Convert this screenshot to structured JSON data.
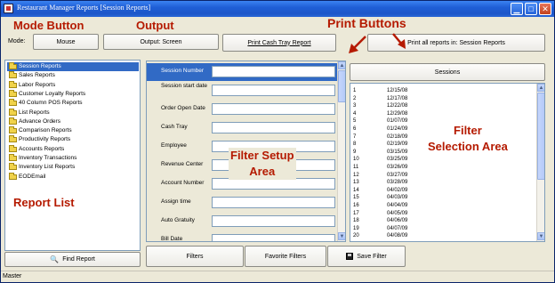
{
  "window": {
    "title": "Restaurant Manager Reports [Session Reports]"
  },
  "toolbar": {
    "mode_label": "Mode:",
    "mode_value": "Mouse",
    "output_button": "Output: Screen",
    "print_tray_button": "Print Cash Tray Report",
    "print_all_button": "Print all reports in: Session Reports"
  },
  "annotations": {
    "mode_button": "Mode Button",
    "output": "Output",
    "print_buttons": "Print Buttons",
    "filter_setup_area": "Filter Setup\nArea",
    "filter_selection_area": "Filter\nSelection Area",
    "report_list": "Report List"
  },
  "reports": {
    "items": [
      "Session Reports",
      "Sales Reports",
      "Labor Reports",
      "Customer Loyalty Reports",
      "40 Column POS Reports",
      "List Reports",
      "Advance Orders",
      "Comparison Reports",
      "Productivity Reports",
      "Accounts Reports",
      "Inventory Transactions",
      "Inventory List Reports",
      "EODEmail"
    ],
    "selected_index": 0,
    "find_button": "Find Report"
  },
  "filters": {
    "fields": [
      "Session Number",
      "Session start date",
      "Order Open Date",
      "Cash Tray",
      "Employee",
      "Revenue Center",
      "Account Number",
      "Assign time",
      "Auto Gratuity",
      "Bill Date"
    ],
    "active_index": 0
  },
  "sessions": {
    "header_button": "Sessions",
    "rows": [
      {
        "num": "1",
        "date": "12/15/08"
      },
      {
        "num": "2",
        "date": "12/17/08"
      },
      {
        "num": "3",
        "date": "12/22/08"
      },
      {
        "num": "4",
        "date": "12/29/08"
      },
      {
        "num": "5",
        "date": "01/07/09"
      },
      {
        "num": "6",
        "date": "01/24/09"
      },
      {
        "num": "7",
        "date": "02/18/09"
      },
      {
        "num": "8",
        "date": "02/19/09"
      },
      {
        "num": "9",
        "date": "03/15/09"
      },
      {
        "num": "10",
        "date": "03/25/09"
      },
      {
        "num": "11",
        "date": "03/26/09"
      },
      {
        "num": "12",
        "date": "03/27/09"
      },
      {
        "num": "13",
        "date": "03/28/09"
      },
      {
        "num": "14",
        "date": "04/02/09"
      },
      {
        "num": "15",
        "date": "04/03/09"
      },
      {
        "num": "16",
        "date": "04/04/09"
      },
      {
        "num": "17",
        "date": "04/05/09"
      },
      {
        "num": "18",
        "date": "04/06/09"
      },
      {
        "num": "19",
        "date": "04/07/09"
      },
      {
        "num": "20",
        "date": "04/08/09"
      }
    ]
  },
  "bottom_buttons": {
    "filters": "Filters",
    "favorite_filters": "Favorite Filters",
    "save_filter": "Save Filter"
  },
  "status": {
    "text": "Master"
  },
  "colors": {
    "selection": "#316ac5",
    "annotation": "#b51a00",
    "titlebar": "#1f5fd6"
  }
}
